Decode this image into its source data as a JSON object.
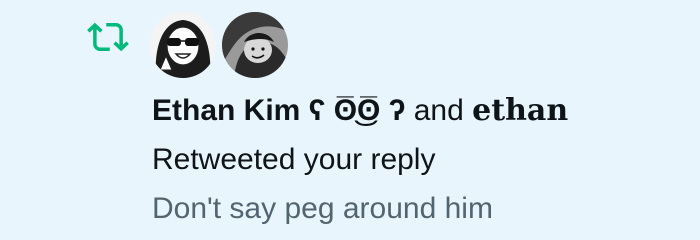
{
  "notification": {
    "type_icon": "retweet-icon",
    "accent_color": "#00ba7c",
    "background_color": "#e8f5fd",
    "avatars": [
      {
        "name": "avatar-ethan-kim"
      },
      {
        "name": "avatar-ethan"
      }
    ],
    "user_1": "Ethan Kim ʕ ʘ̅͜ʘ̅ ʔ",
    "connector": " and ",
    "user_2": "𝐞𝐭𝐡𝐚𝐧",
    "action": "Retweeted your reply",
    "snippet": "Don't say peg around him"
  }
}
